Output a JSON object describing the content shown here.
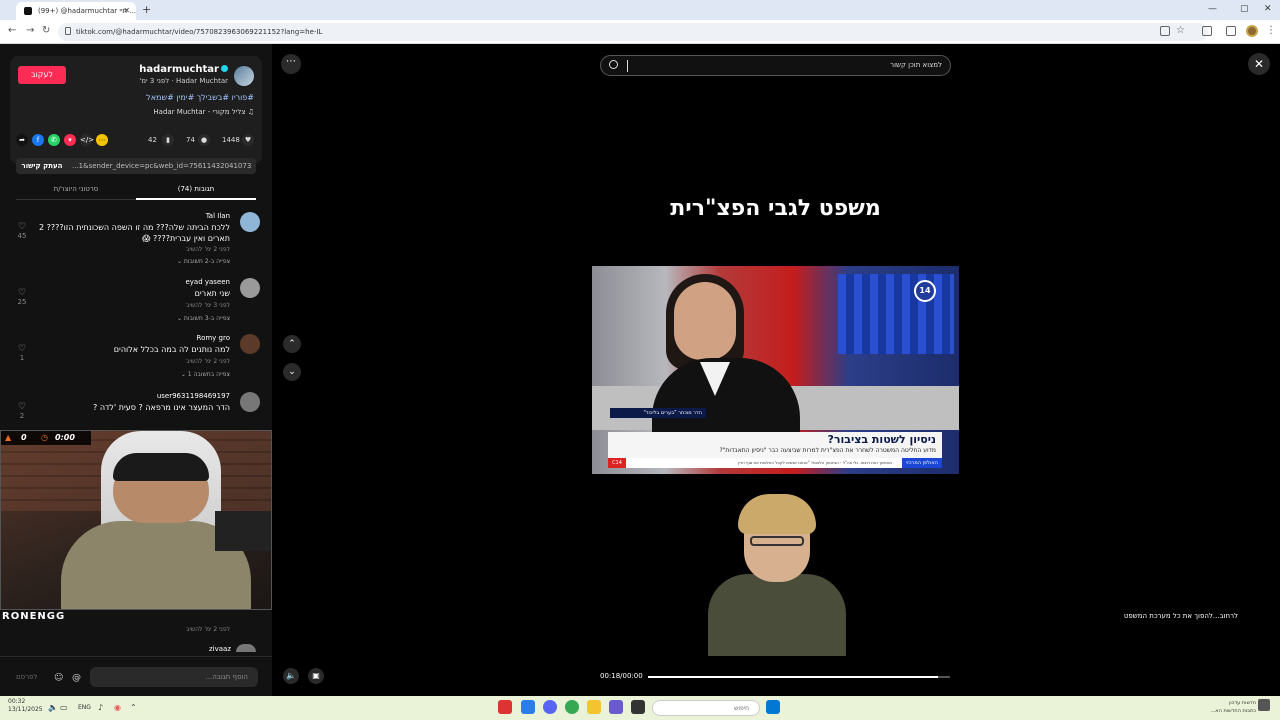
{
  "browser": {
    "tab_title": "‎(99+) ⁦@hadarmuchtar⁩ ‏‏ תיי...",
    "new_tab": "+",
    "url": "tiktok.com/@hadarmuchtar/video/7570823963069221152?lang=he-IL",
    "minimize": "—",
    "maximize": "▢",
    "close": "✕"
  },
  "post": {
    "follow_label": "לעקוב",
    "username": "hadarmuchtar",
    "nickname_line": "Hadar Muchtar · לפני 3 ימ'",
    "hashtags": "#פוריו #בשבילך #ימין #שמאל",
    "music": "♫ צליל מקורי - Hadar Muchtar",
    "likes": "1448",
    "comments": "74",
    "saves": "42",
    "copy_link_label": "העתק קישור",
    "link": "...1&sender_device=pc&web_id=7561143204107339276",
    "tab_comments": "תגובות (74)",
    "tab_creator_videos": "סרטוני היוצר/ת",
    "add_comment_placeholder": "הוסף תגובה...",
    "post_label": "לפרסם"
  },
  "comments": [
    {
      "user": "Tal Ilan",
      "text": "ללכת הביתה שלה??? מה זו השפה השכונתית הזו???? 2 תארים ואין עברית???? 😱",
      "meta": "לפני 2 ימ'   להשיב",
      "replies": "צפייה ב-2 תשובות ⌄",
      "likes": "45"
    },
    {
      "user": "eyad yaseen",
      "text": "שני תארים",
      "meta": "לפני 3 ימ'   להשיב",
      "replies": "צפייה ב-3 תשובות ⌄",
      "likes": "25"
    },
    {
      "user": "Romy gro",
      "text": "למה נותנים לה במה בכלל אלוהים",
      "meta": "לפני 2 ימ'   להשיב",
      "replies": "צפייה בתשובה 1 ⌄",
      "likes": "1"
    },
    {
      "user": "user9631198469197",
      "text": "הדר המעצר אינו מרפאה ? סעית 'לדה ?",
      "meta": "",
      "replies": "",
      "likes": "2"
    }
  ],
  "last_comment": {
    "text": "לרחוב...להפוך את כל מערכת המשפט",
    "meta": "לפני 2 ימ'   להשיב",
    "next_user": "zivaaz"
  },
  "webcam": {
    "counter": "0",
    "timer": "0:00",
    "brand": "RONENGG"
  },
  "video": {
    "search_placeholder": "למצוא תוכן קשור",
    "title": "משפט לגבי הפצ\"רית",
    "channel_logo": "14",
    "name_strap": "הדר מוכתר \"בערים בליכוד\"",
    "chyron_headline": "ניסיון לשטות בציבור?",
    "chyron_sub": "מדוע החליטה המשטרה לשחרר את הפצ\"רית למרות שביצעה כבר \"ניסיון התאבדות\"?",
    "ticker_channel": "האולפן המרכזי",
    "ticker_logo": "C14",
    "ticker_text": "מהמשך ואת רוצחו. גלי צה\"ל - הביטחון הלאומי: \"אנחנו אנשים לקבל החלטות את סוף הדין",
    "time": "00:18/00:00",
    "progress": 0.96
  },
  "taskbar": {
    "time": "00:32",
    "date": "13/11/2025",
    "lang": "ENG",
    "search_placeholder": "חיפוש",
    "notify_title": "חדשות עדכון",
    "notify_sub": "כתבות החדשות הא..."
  },
  "colors": {
    "accent": "#fe2c55",
    "hashtag": "#a3c4ff",
    "taskbar": "#eaf2d8"
  }
}
